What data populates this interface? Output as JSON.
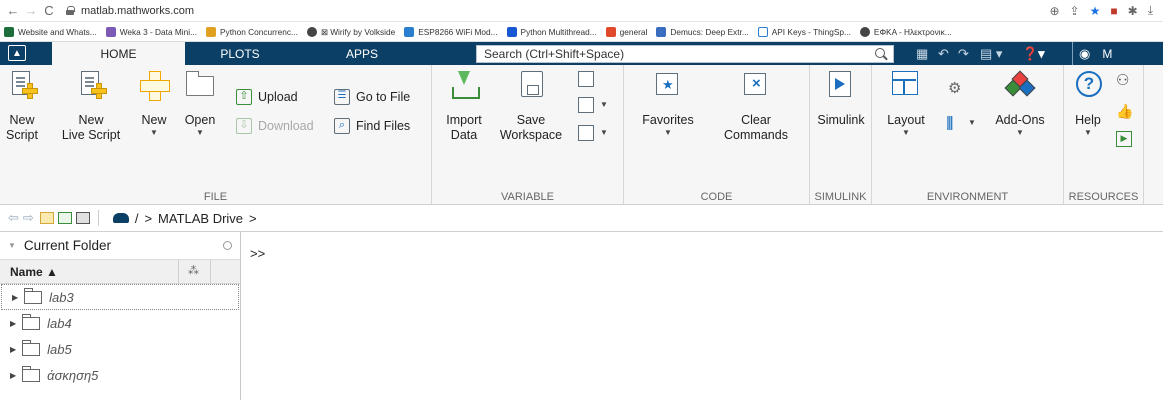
{
  "browser": {
    "url": "matlab.mathworks.com",
    "bookmarks": [
      {
        "label": "Website and Whats...",
        "color": "#1e6e3c"
      },
      {
        "label": "Weka 3 - Data Mini...",
        "color": "#7b5bb5"
      },
      {
        "label": "Python Concurrenc...",
        "color": "#e0a020"
      },
      {
        "label": "⊠ Wirify by Volkside",
        "color": "#444444"
      },
      {
        "label": "ESP8266 WiFi Mod...",
        "color": "#2a7fd0"
      },
      {
        "label": "Python Multithread...",
        "color": "#1a57d6"
      },
      {
        "label": "general",
        "color": "#e04a2a"
      },
      {
        "label": "Demucs: Deep Extr...",
        "color": "#3a6ec0"
      },
      {
        "label": "API Keys - ThingSp...",
        "color": "#2a7fd0"
      },
      {
        "label": "ΕΦΚΑ - Ηλεκτρονικ...",
        "color": "#444444"
      }
    ]
  },
  "tabs": {
    "home": "HOME",
    "plots": "PLOTS",
    "apps": "APPS",
    "search_placeholder": "Search (Ctrl+Shift+Space)",
    "user_initials": "M"
  },
  "file": {
    "label": "FILE",
    "new_script": [
      "New",
      "Script"
    ],
    "new_live_script": [
      "New",
      "Live Script"
    ],
    "new": "New",
    "open": "Open",
    "upload": "Upload",
    "download": "Download",
    "go_to_file": "Go to File",
    "find_files": "Find Files"
  },
  "variable": {
    "label": "VARIABLE",
    "import_data": [
      "Import",
      "Data"
    ],
    "save_workspace": [
      "Save",
      "Workspace"
    ]
  },
  "code": {
    "label": "CODE",
    "favorites": "Favorites",
    "clear_commands": [
      "Clear",
      "Commands"
    ]
  },
  "simulink": {
    "label": "SIMULINK",
    "simulink": "Simulink"
  },
  "environment": {
    "label": "ENVIRONMENT",
    "layout": "Layout",
    "add_ons": "Add-Ons"
  },
  "resources": {
    "label": "RESOURCES",
    "help": "Help"
  },
  "path": {
    "root": "/",
    "drive": "MATLAB Drive"
  },
  "current_folder": {
    "title": "Current Folder",
    "column_name": "Name ▲",
    "items": [
      "lab3",
      "lab4",
      "lab5",
      "άσκηση5"
    ]
  },
  "command_window": {
    "prompt": ">>"
  }
}
